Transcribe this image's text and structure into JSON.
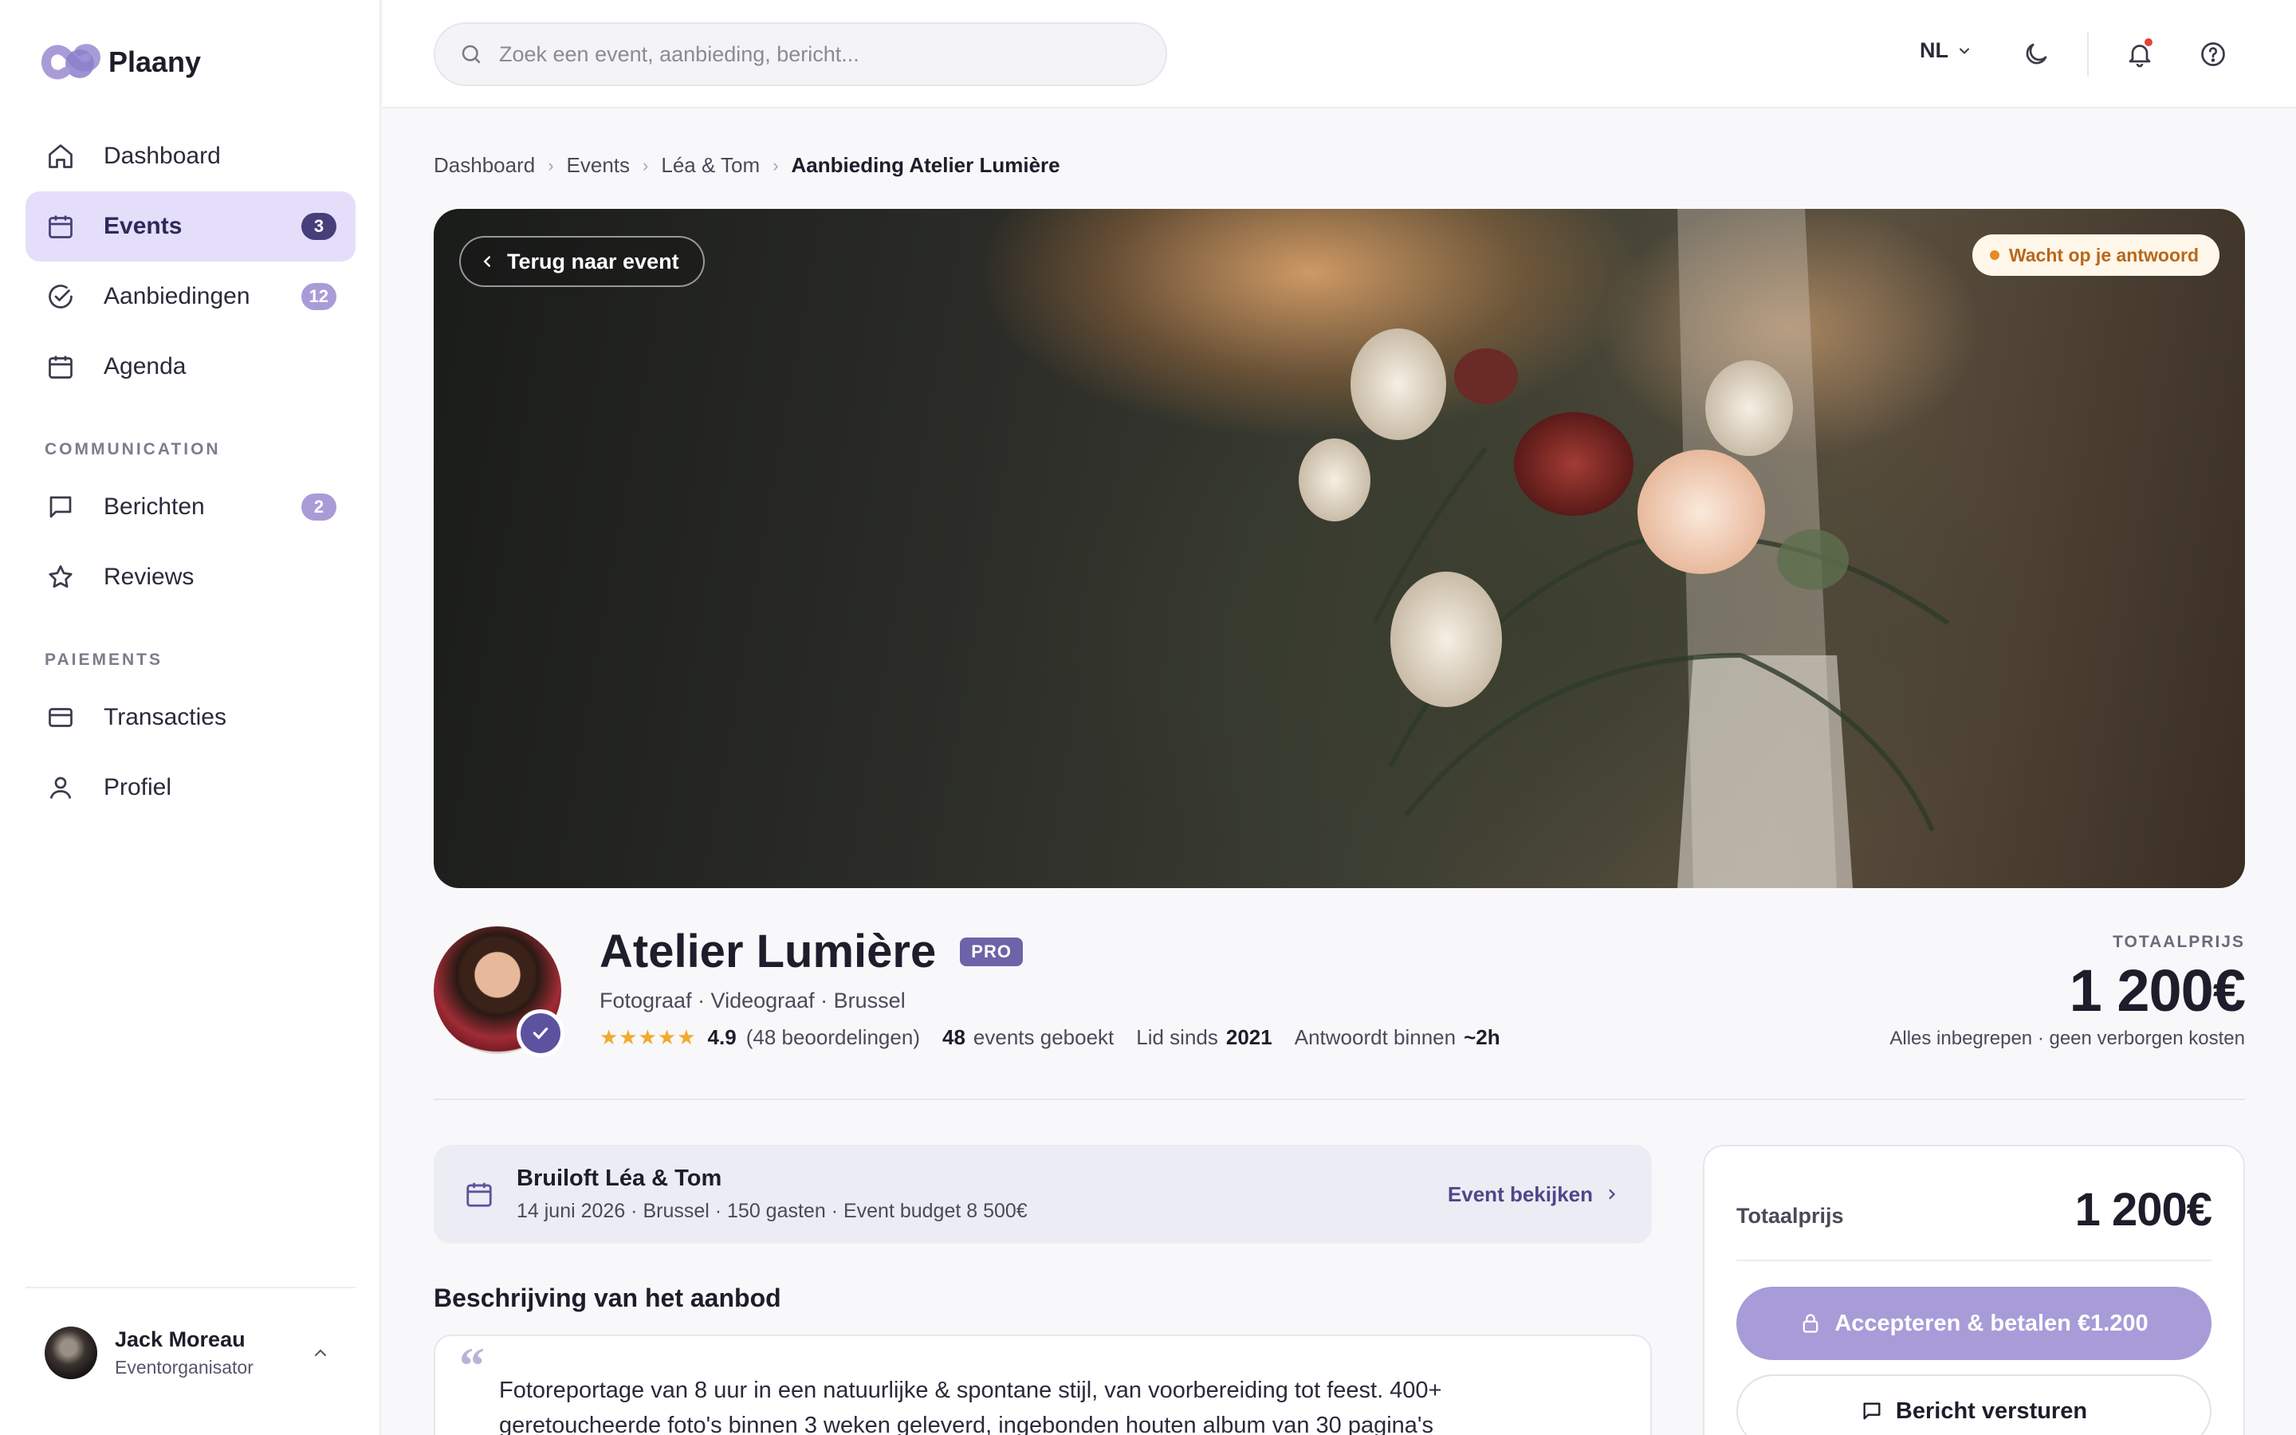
{
  "app": {
    "name": "Plaany"
  },
  "sidebar": {
    "items": [
      {
        "label": "Dashboard",
        "icon": "home-icon"
      },
      {
        "label": "Events",
        "icon": "calendar-icon",
        "badge": "3",
        "active": true
      },
      {
        "label": "Aanbiedingen",
        "icon": "check-circle-icon",
        "badge": "12"
      },
      {
        "label": "Agenda",
        "icon": "calendar-icon"
      }
    ],
    "section_communication": "COMMUNICATION",
    "communication_items": [
      {
        "label": "Berichten",
        "icon": "message-icon",
        "badge": "2"
      },
      {
        "label": "Reviews",
        "icon": "star-icon"
      }
    ],
    "section_payments": "PAIEMENTS",
    "payment_items": [
      {
        "label": "Transacties",
        "icon": "credit-card-icon"
      },
      {
        "label": "Profiel",
        "icon": "user-icon"
      }
    ],
    "user": {
      "name": "Jack Moreau",
      "role": "Eventorganisator"
    }
  },
  "topbar": {
    "search_placeholder": "Zoek een event, aanbieding, bericht...",
    "language": "NL"
  },
  "breadcrumb": [
    "Dashboard",
    "Events",
    "Léa & Tom",
    "Aanbieding Atelier Lumière"
  ],
  "hero": {
    "back_label": "Terug naar event",
    "status": "Wacht op je antwoord",
    "status_color": "#b9671a"
  },
  "vendor": {
    "name": "Atelier Lumière",
    "badge": "PRO",
    "subtitle": "Fotograaf · Videograaf · Brussel",
    "stars": "★★★★★",
    "rating": "4.9",
    "reviews": "(48 beoordelingen)",
    "events_count": "48",
    "events_label": "events geboekt",
    "member_label": "Lid sinds",
    "member_year": "2021",
    "response_label": "Antwoordt binnen",
    "response_time": "~2h"
  },
  "total": {
    "label": "TOTAALPRIJS",
    "value": "1 200€",
    "note": "Alles inbegrepen · geen verborgen kosten"
  },
  "event": {
    "title": "Bruiloft Léa & Tom",
    "details": "14 juni 2026 · Brussel · 150 gasten · Event budget 8 500€",
    "link": "Event bekijken"
  },
  "description": {
    "title": "Beschrijving van het aanbod",
    "text": "Fotoreportage van 8 uur in een natuurlijke & spontane stijl, van voorbereiding tot feest. 400+ geretoucheerde foto's binnen 3 weken geleverd, ingebonden houten album van 30 pagina's"
  },
  "summary": {
    "label": "Totaalprijs",
    "value": "1 200€",
    "accept_label": "Accepteren & betalen €1.200",
    "message_label": "Bericht versturen",
    "accent": "#a79cd8"
  }
}
